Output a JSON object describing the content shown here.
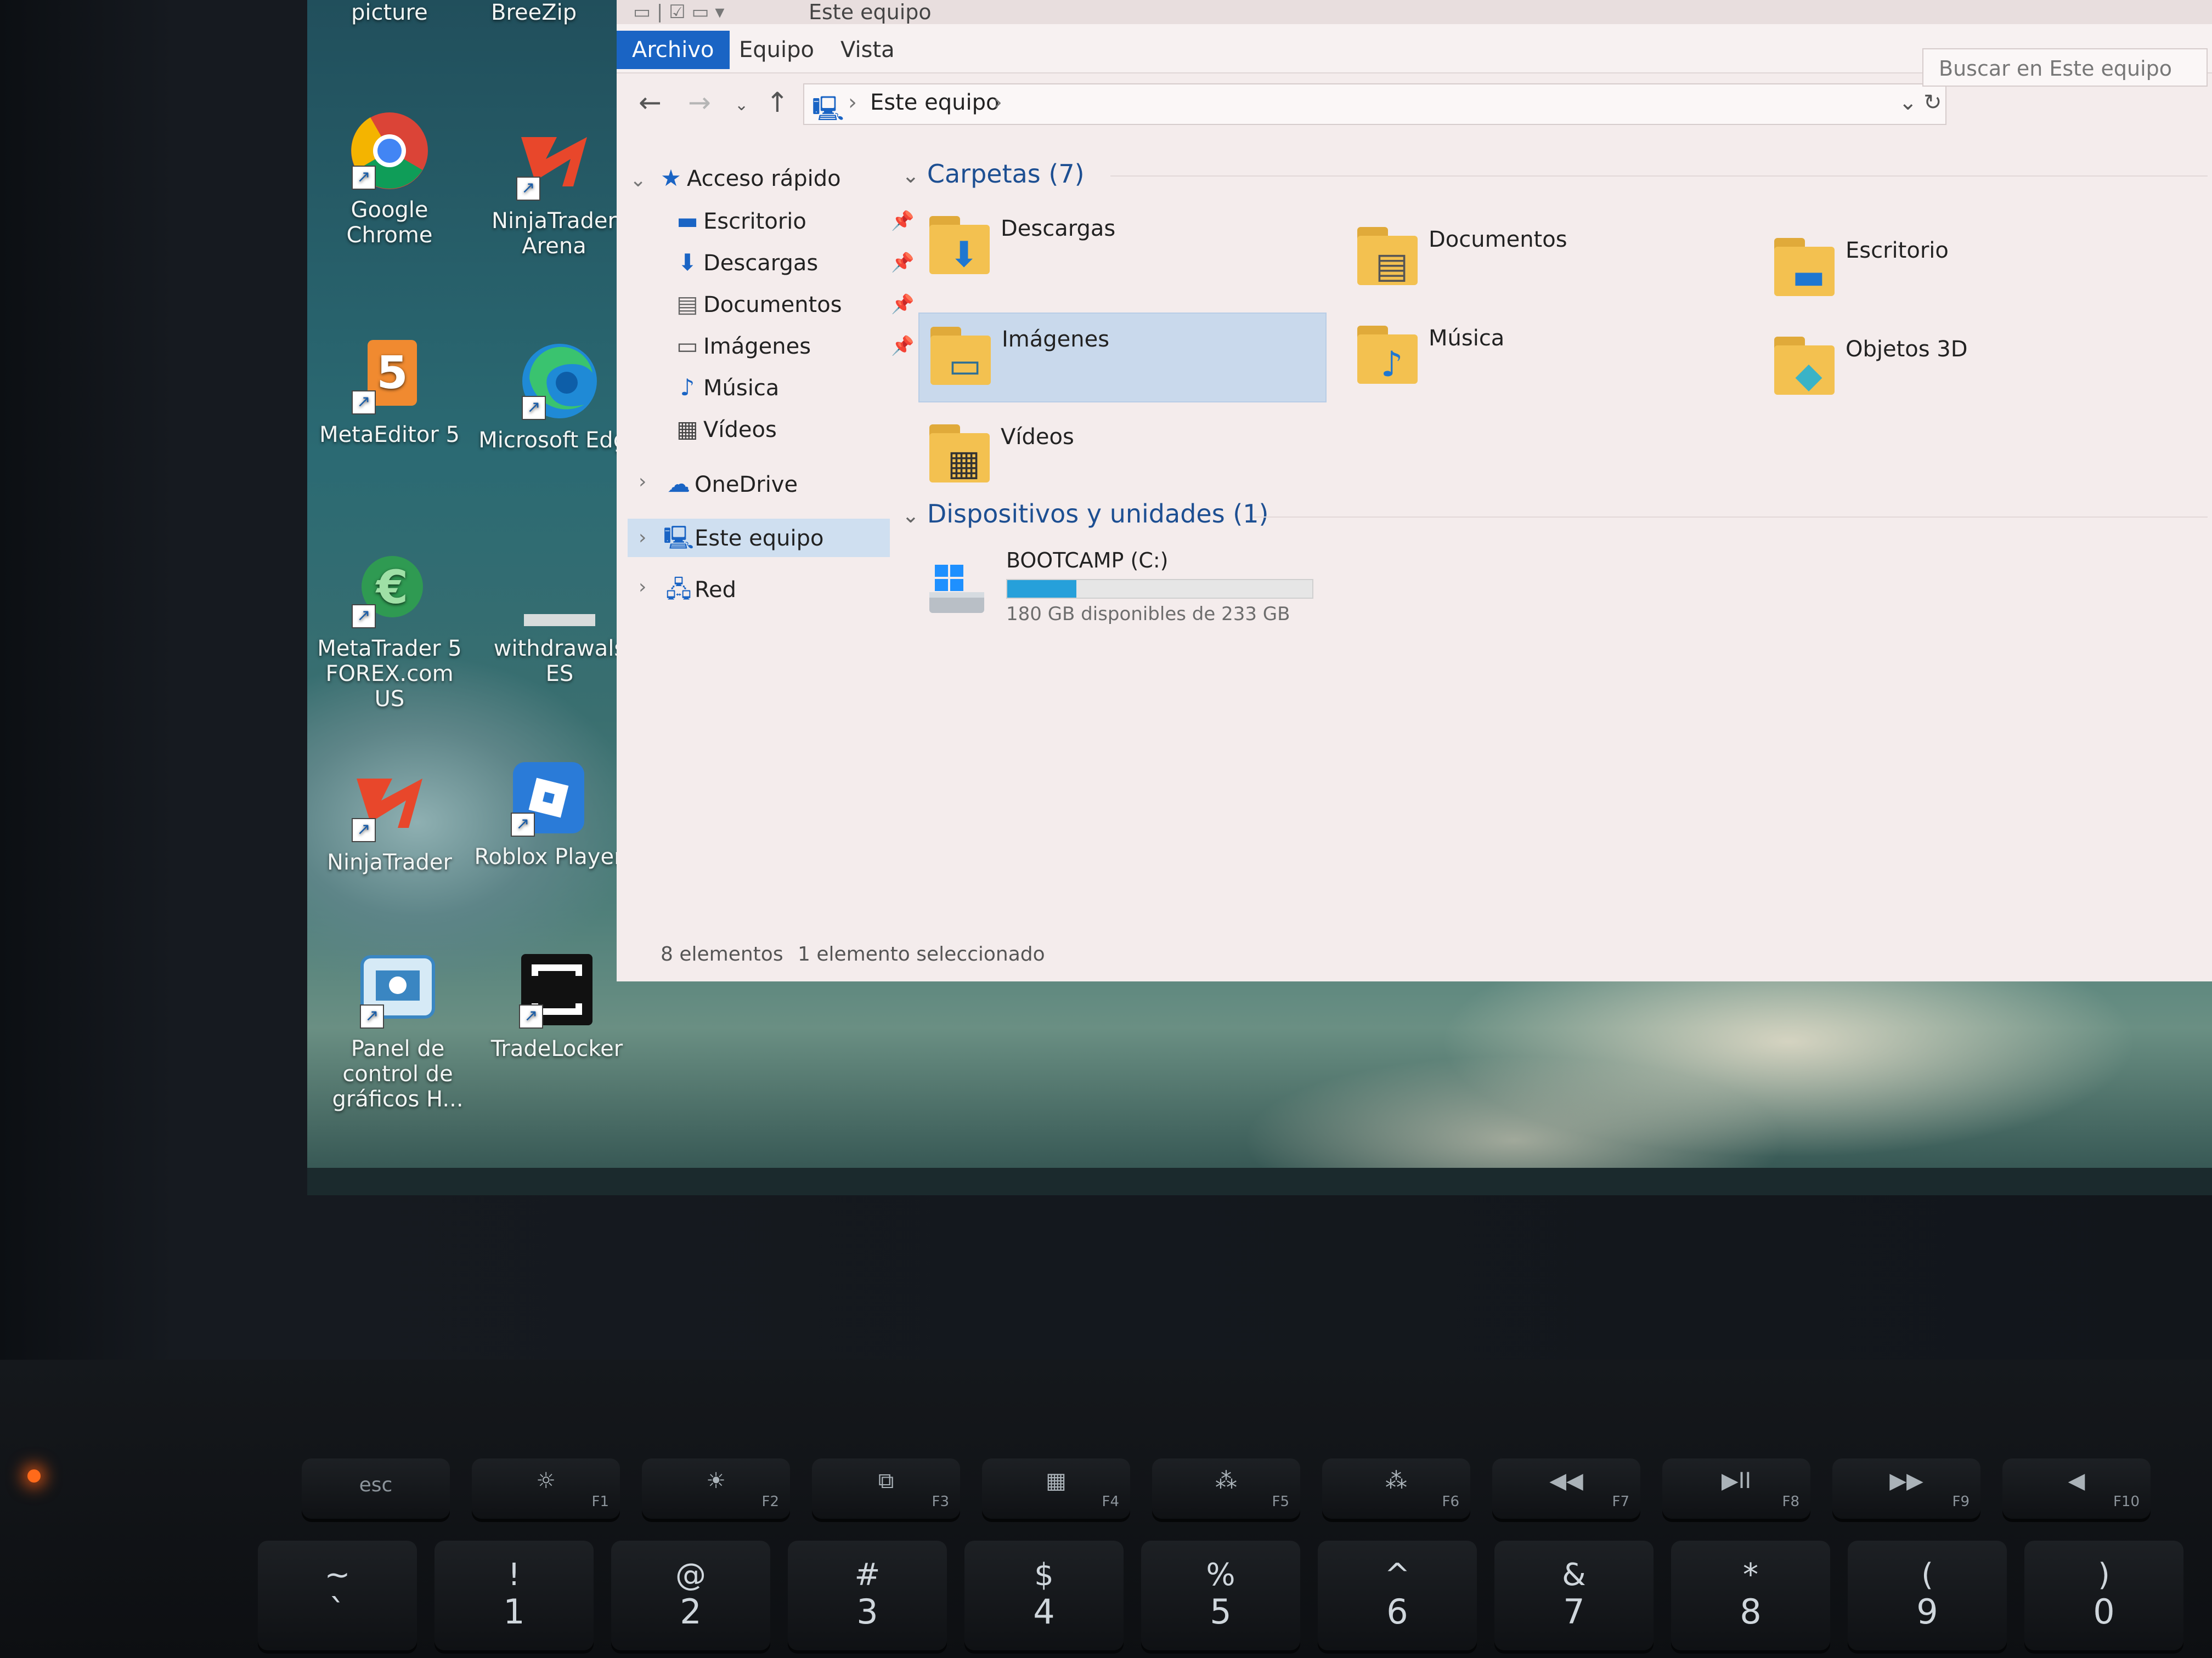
{
  "desktop": {
    "partial_labels": [
      "picture",
      "BreeZip"
    ],
    "icons": [
      {
        "label": "Google Chrome",
        "icon": "chrome-icon"
      },
      {
        "label": "NinjaTrader Arena",
        "icon": "ninjatrader-icon"
      },
      {
        "label": "MetaEditor 5",
        "icon": "metaeditor-icon"
      },
      {
        "label": "Microsoft Edge",
        "icon": "edge-icon"
      },
      {
        "label": "MetaTrader 5 FOREX.com US",
        "icon": "metatrader-icon"
      },
      {
        "label": "withdrawals ES",
        "icon": "document-icon"
      },
      {
        "label": "NinjaTrader",
        "icon": "ninjatrader-icon"
      },
      {
        "label": "Roblox Player",
        "icon": "roblox-icon"
      },
      {
        "label": "Panel de control de gráficos H...",
        "icon": "intel-graphics-icon"
      },
      {
        "label": "TradeLocker",
        "icon": "tradelocker-icon"
      }
    ]
  },
  "window": {
    "title": "Este equipo",
    "ribbon_tabs": [
      "Archivo",
      "Equipo",
      "Vista"
    ],
    "address_path": [
      "Este equipo"
    ],
    "search_placeholder": "Buscar en Este equipo",
    "nav": {
      "quick_access": "Acceso rápido",
      "pinned": [
        "Escritorio",
        "Descargas",
        "Documentos",
        "Imágenes"
      ],
      "unpinned": [
        "Música",
        "Vídeos"
      ],
      "onedrive": "OneDrive",
      "this_pc": "Este equipo",
      "network": "Red"
    },
    "folders_header": "Carpetas (7)",
    "folders": [
      {
        "name": "Descargas",
        "icon": "download-arrow-icon",
        "selected": false
      },
      {
        "name": "Documentos",
        "icon": "document-icon",
        "selected": false
      },
      {
        "name": "Escritorio",
        "icon": "desktop-icon",
        "selected": false
      },
      {
        "name": "Imágenes",
        "icon": "picture-icon",
        "selected": true
      },
      {
        "name": "Música",
        "icon": "music-note-icon",
        "selected": false
      },
      {
        "name": "Objetos 3D",
        "icon": "cube-icon",
        "selected": false
      },
      {
        "name": "Vídeos",
        "icon": "film-icon",
        "selected": false
      }
    ],
    "devices_header": "Dispositivos y unidades (1)",
    "drive": {
      "name": "BOOTCAMP (C:)",
      "free_text": "180 GB disponibles de 233 GB",
      "used_fraction": 0.227
    },
    "status": {
      "items": "8 elementos",
      "selection": "1 elemento seleccionado"
    }
  },
  "keyboard": {
    "function_row": [
      {
        "label": "esc",
        "fn": ""
      },
      {
        "label": "☼",
        "fn": "F1"
      },
      {
        "label": "☀",
        "fn": "F2"
      },
      {
        "label": "⧉",
        "fn": "F3"
      },
      {
        "label": "▦",
        "fn": "F4"
      },
      {
        "label": "⁂",
        "fn": "F5"
      },
      {
        "label": "⁂",
        "fn": "F6"
      },
      {
        "label": "◀◀",
        "fn": "F7"
      },
      {
        "label": "▶II",
        "fn": "F8"
      },
      {
        "label": "▶▶",
        "fn": "F9"
      },
      {
        "label": "◀",
        "fn": "F10"
      }
    ],
    "number_row": [
      {
        "top": "~",
        "bot": "`"
      },
      {
        "top": "!",
        "bot": "1"
      },
      {
        "top": "@",
        "bot": "2"
      },
      {
        "top": "#",
        "bot": "3"
      },
      {
        "top": "$",
        "bot": "4"
      },
      {
        "top": "%",
        "bot": "5"
      },
      {
        "top": "^",
        "bot": "6"
      },
      {
        "top": "&",
        "bot": "7"
      },
      {
        "top": "*",
        "bot": "8"
      },
      {
        "top": "(",
        "bot": "9"
      },
      {
        "top": ")",
        "bot": "0"
      }
    ]
  }
}
